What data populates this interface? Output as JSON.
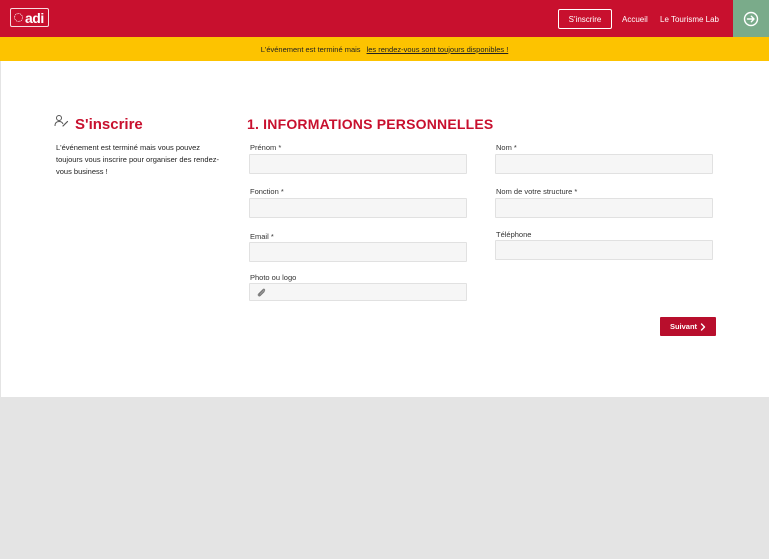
{
  "header": {
    "logo_text": "adi",
    "signup_button": "S'inscrire",
    "nav": [
      "Accueil",
      "Le Tourisme Lab"
    ]
  },
  "banner": {
    "text": "L'événement est terminé mais",
    "link": "les rendez-vous sont toujours disponibles !"
  },
  "sidebar": {
    "title": "S'inscrire",
    "description": "L'événement est terminé mais vous pouvez toujours vous inscrire pour organiser des rendez-vous business !"
  },
  "form": {
    "section_title": "1. INFORMATIONS PERSONNELLES",
    "fields": {
      "prenom": {
        "label": "Prénom *",
        "value": ""
      },
      "nom": {
        "label": "Nom *",
        "value": ""
      },
      "fonction": {
        "label": "Fonction *",
        "value": ""
      },
      "structure": {
        "label": "Nom de votre structure *",
        "value": ""
      },
      "email": {
        "label": "Email *",
        "value": ""
      },
      "telephone": {
        "label": "Téléphone",
        "value": ""
      },
      "photo": {
        "label": "Photo ou logo",
        "value": ""
      }
    },
    "next_button": "Suivant"
  },
  "colors": {
    "brand_red": "#c8102e",
    "banner_yellow": "#fdc300",
    "login_green": "#7aab8a"
  },
  "icons": {
    "login": "login-arrow-icon",
    "sidebar": "signup-pen-icon",
    "attach": "paperclip-icon",
    "next": "chevron-right-icon"
  }
}
